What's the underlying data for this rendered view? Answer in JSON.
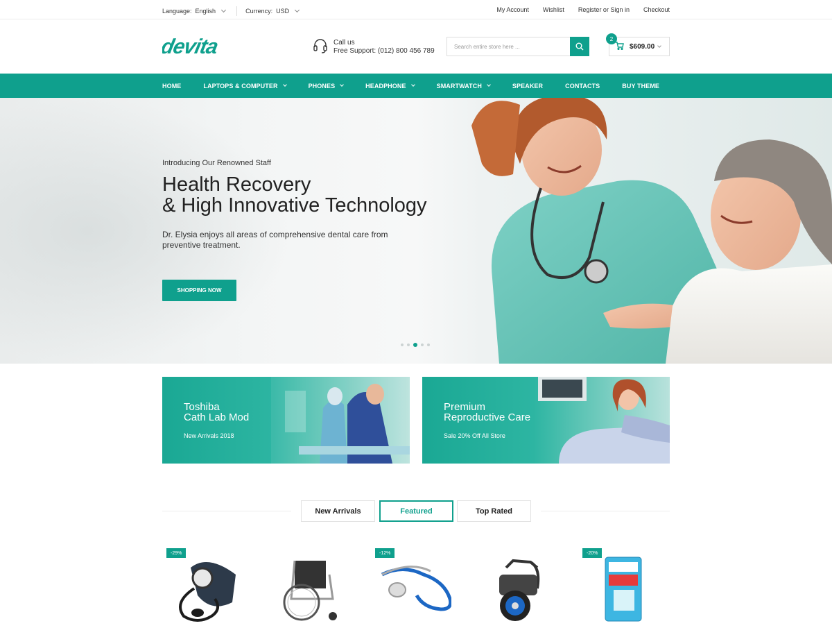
{
  "topbar": {
    "language_label": "Language:",
    "language_value": "English",
    "currency_label": "Currency:",
    "currency_value": "USD",
    "links": [
      "My Account",
      "Wishlist",
      "Register or Sign in",
      "Checkout"
    ]
  },
  "header": {
    "logo_text": "devita",
    "support_line1": "Call us",
    "support_line2": "Free Support: (012) 800 456 789",
    "search_placeholder": "Search entire store here ...",
    "cart_count": "2",
    "cart_total": "$609.00"
  },
  "nav": {
    "items": [
      {
        "label": "HOME",
        "dropdown": false
      },
      {
        "label": "LAPTOPS & COMPUTER",
        "dropdown": true
      },
      {
        "label": "PHONES",
        "dropdown": true
      },
      {
        "label": "HEADPHONE",
        "dropdown": true
      },
      {
        "label": "SMARTWATCH",
        "dropdown": true
      },
      {
        "label": "SPEAKER",
        "dropdown": false
      },
      {
        "label": "CONTACTS",
        "dropdown": false
      },
      {
        "label": "BUY THEME",
        "dropdown": false
      }
    ]
  },
  "hero": {
    "intro": "Introducing Our Renowned Staff",
    "title_line1": "Health Recovery",
    "title_line2": "& High Innovative Technology",
    "description": "Dr. Elysia enjoys all areas of comprehensive dental care from preventive treatment.",
    "button_label": "SHOPPING NOW",
    "slide_count": 5,
    "active_slide": 3
  },
  "banners": [
    {
      "title_line1": "Toshiba",
      "title_line2": "Cath Lab Mod",
      "subtitle": "New Arrivals 2018"
    },
    {
      "title_line1": "Premium",
      "title_line2": "Reproductive Care",
      "subtitle": "Sale 20% Off All Store"
    }
  ],
  "tabs": [
    {
      "label": "New Arrivals",
      "active": false
    },
    {
      "label": "Featured",
      "active": true
    },
    {
      "label": "Top Rated",
      "active": false
    }
  ],
  "products": [
    {
      "name": "blood-pressure-monitor",
      "discount": "-29%"
    },
    {
      "name": "wheelchair",
      "discount": ""
    },
    {
      "name": "stethoscope",
      "discount": "-12%"
    },
    {
      "name": "mobility-device",
      "discount": ""
    },
    {
      "name": "dental-floss",
      "discount": "-20%"
    }
  ],
  "colors": {
    "accent": "#0fa08d"
  }
}
